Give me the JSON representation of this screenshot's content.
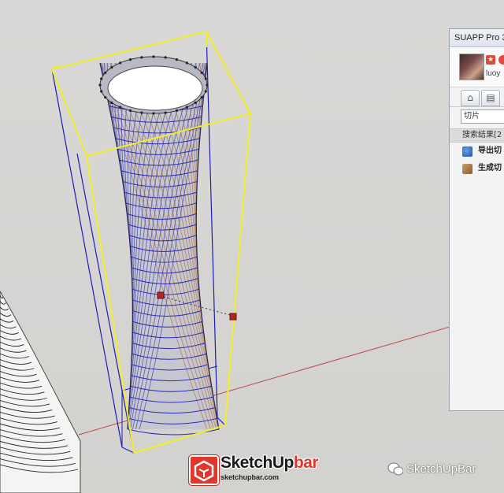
{
  "panel": {
    "title": "SUAPP Pro 3",
    "badge": "★",
    "username": "luoy",
    "search_value": "切片",
    "results_header": "搜索结果[2",
    "items": [
      {
        "label": "导出切",
        "icon": "export-plugin-icon"
      },
      {
        "label": "生成切",
        "icon": "slice-plugin-icon"
      }
    ],
    "tabs": [
      {
        "icon": "home-icon"
      },
      {
        "icon": "toolbar-icon"
      }
    ]
  },
  "watermark": {
    "brand_left": "SketchUp",
    "brand_right": "bar",
    "url": "sketchupbar.com",
    "wechat_label": "SketchUpBar"
  },
  "colors": {
    "selection_yellow": "#f2ee2a",
    "bbox_blue": "#1d1db3",
    "axis_red": "#b83a3a",
    "lattice_tan": "#b58a6a"
  }
}
